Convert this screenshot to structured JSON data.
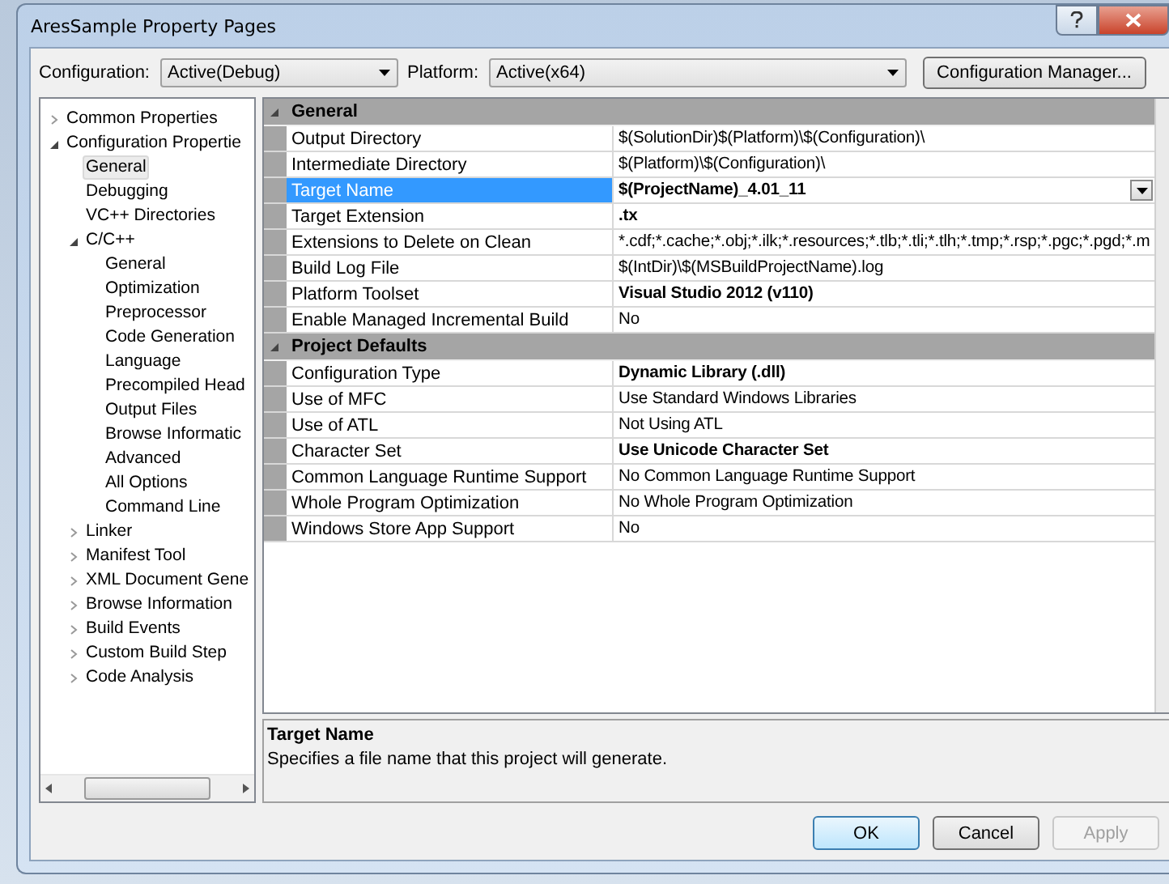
{
  "window": {
    "title": "AresSample Property Pages"
  },
  "toolbar": {
    "configuration_label": "Configuration:",
    "configuration_value": "Active(Debug)",
    "platform_label": "Platform:",
    "platform_value": "Active(x64)",
    "manager_button": "Configuration Manager..."
  },
  "tree": [
    {
      "label": "Common Properties",
      "expanded": false,
      "selected": false
    },
    {
      "label": "Configuration Propertie",
      "expanded": true,
      "selected": false,
      "children": [
        {
          "label": "General",
          "selected": true
        },
        {
          "label": "Debugging",
          "selected": false
        },
        {
          "label": "VC++ Directories",
          "selected": false
        },
        {
          "label": "C/C++",
          "expanded": true,
          "selected": false,
          "children": [
            {
              "label": "General",
              "selected": false
            },
            {
              "label": "Optimization",
              "selected": false
            },
            {
              "label": "Preprocessor",
              "selected": false
            },
            {
              "label": "Code Generation",
              "selected": false
            },
            {
              "label": "Language",
              "selected": false
            },
            {
              "label": "Precompiled Head",
              "selected": false
            },
            {
              "label": "Output Files",
              "selected": false
            },
            {
              "label": "Browse Informatic",
              "selected": false
            },
            {
              "label": "Advanced",
              "selected": false
            },
            {
              "label": "All Options",
              "selected": false
            },
            {
              "label": "Command Line",
              "selected": false
            }
          ]
        },
        {
          "label": "Linker",
          "expanded": false,
          "selected": false
        },
        {
          "label": "Manifest Tool",
          "expanded": false,
          "selected": false
        },
        {
          "label": "XML Document Gene",
          "expanded": false,
          "selected": false
        },
        {
          "label": "Browse Information",
          "expanded": false,
          "selected": false
        },
        {
          "label": "Build Events",
          "expanded": false,
          "selected": false
        },
        {
          "label": "Custom Build Step",
          "expanded": false,
          "selected": false
        },
        {
          "label": "Code Analysis",
          "expanded": false,
          "selected": false
        }
      ]
    }
  ],
  "property_grid": [
    {
      "category": "General",
      "expanded": true,
      "rows": [
        {
          "name": "Output Directory",
          "value": "$(SolutionDir)$(Platform)\\$(Configuration)\\",
          "bold": false,
          "selected": false
        },
        {
          "name": "Intermediate Directory",
          "value": "$(Platform)\\$(Configuration)\\",
          "bold": false,
          "selected": false
        },
        {
          "name": "Target Name",
          "value": "$(ProjectName)_4.01_11",
          "bold": true,
          "selected": true
        },
        {
          "name": "Target Extension",
          "value": ".tx",
          "bold": true,
          "selected": false
        },
        {
          "name": "Extensions to Delete on Clean",
          "value": "*.cdf;*.cache;*.obj;*.ilk;*.resources;*.tlb;*.tli;*.tlh;*.tmp;*.rsp;*.pgc;*.pgd;*.m",
          "bold": false,
          "selected": false
        },
        {
          "name": "Build Log File",
          "value": "$(IntDir)\\$(MSBuildProjectName).log",
          "bold": false,
          "selected": false
        },
        {
          "name": "Platform Toolset",
          "value": "Visual Studio 2012 (v110)",
          "bold": true,
          "selected": false
        },
        {
          "name": "Enable Managed Incremental Build",
          "value": "No",
          "bold": false,
          "selected": false
        }
      ]
    },
    {
      "category": "Project Defaults",
      "expanded": true,
      "rows": [
        {
          "name": "Configuration Type",
          "value": "Dynamic Library (.dll)",
          "bold": true,
          "selected": false
        },
        {
          "name": "Use of MFC",
          "value": "Use Standard Windows Libraries",
          "bold": false,
          "selected": false
        },
        {
          "name": "Use of ATL",
          "value": "Not Using ATL",
          "bold": false,
          "selected": false
        },
        {
          "name": "Character Set",
          "value": "Use Unicode Character Set",
          "bold": true,
          "selected": false
        },
        {
          "name": "Common Language Runtime Support",
          "value": "No Common Language Runtime Support",
          "bold": false,
          "selected": false
        },
        {
          "name": "Whole Program Optimization",
          "value": "No Whole Program Optimization",
          "bold": false,
          "selected": false
        },
        {
          "name": "Windows Store App Support",
          "value": "No",
          "bold": false,
          "selected": false
        }
      ]
    }
  ],
  "description": {
    "title": "Target Name",
    "text": "Specifies a file name that this project will generate."
  },
  "buttons": [
    {
      "label": "OK",
      "disabled": false,
      "default": true
    },
    {
      "label": "Cancel",
      "disabled": false,
      "default": false
    },
    {
      "label": "Apply",
      "disabled": true,
      "default": false
    }
  ]
}
